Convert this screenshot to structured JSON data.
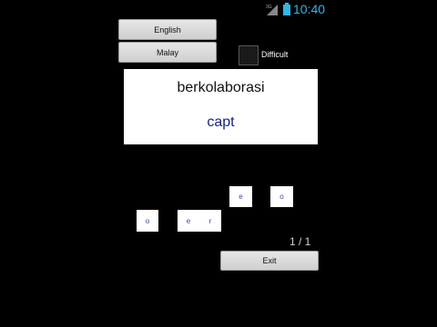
{
  "status": {
    "time": "10:40",
    "signal_label": "3G"
  },
  "lang_buttons": {
    "english": "English",
    "malay": "Malay"
  },
  "difficult": {
    "label": "Difficult",
    "checked": false
  },
  "card": {
    "word": "berkolaborasi",
    "answer": "capt"
  },
  "tiles": [
    "e",
    "o",
    "o",
    "e",
    "r"
  ],
  "progress": {
    "text": "1 / 1"
  },
  "exit_label": "Exit"
}
